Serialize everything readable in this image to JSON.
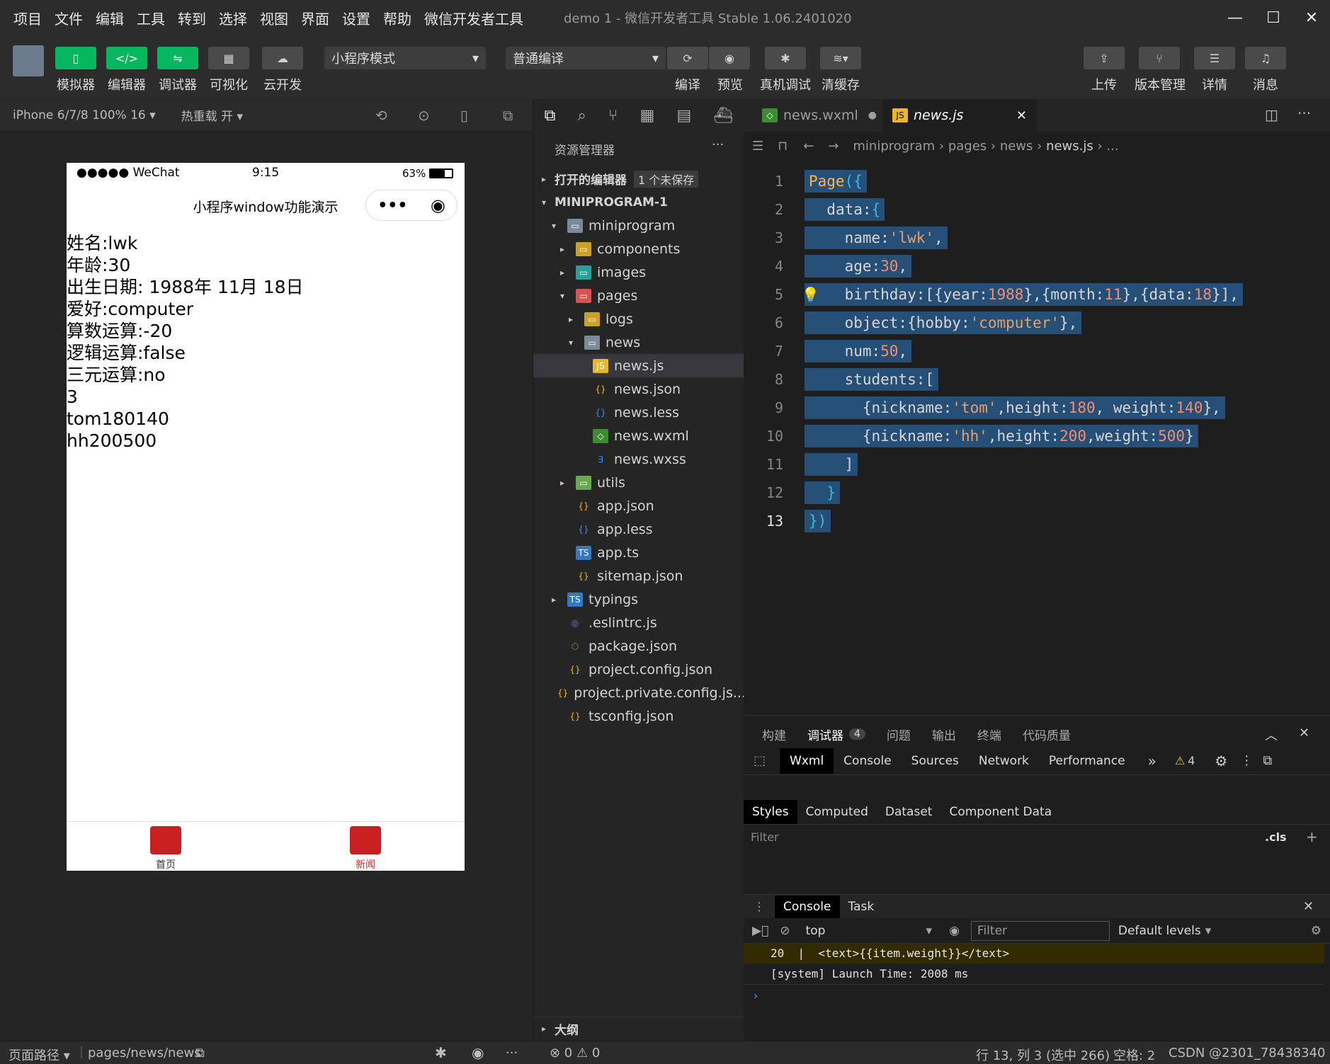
{
  "menubar": {
    "items": [
      "项目",
      "文件",
      "编辑",
      "工具",
      "转到",
      "选择",
      "视图",
      "界面",
      "设置",
      "帮助",
      "微信开发者工具"
    ],
    "title": "demo 1 - 微信开发者工具 Stable 1.06.2401020"
  },
  "toolbar": {
    "simulator": "模拟器",
    "editor": "编辑器",
    "debugger": "调试器",
    "visual": "可视化",
    "cloud": "云开发",
    "mode_select": "小程序模式",
    "compile_select": "普通编译",
    "compile": "编译",
    "preview": "预览",
    "real_debug": "真机调试",
    "clear_cache": "清缓存",
    "upload": "上传",
    "version": "版本管理",
    "details": "详情",
    "messages": "消息"
  },
  "simulator": {
    "device": "iPhone 6/7/8 100% 16 ▾",
    "hot_reload": "热重载 开 ▾",
    "status_left": "●●●●● WeChat",
    "status_time": "9:15",
    "status_battery": "63%",
    "nav_title": "小程序window功能演示",
    "lines": [
      "姓名:lwk",
      "年龄:30",
      "出生日期: 1988年 11月 18日",
      "爱好:computer",
      "算数运算:-20",
      "逻辑运算:false",
      "三元运算:no",
      "3",
      "tom180140",
      "hh200500"
    ],
    "tab_home": "首页",
    "tab_news": "新闻",
    "active_color": "#e02020"
  },
  "explorer": {
    "title": "资源管理器",
    "open_editors": "打开的编辑器",
    "unsaved": "1 个未保存",
    "project": "MINIPROGRAM-1",
    "outline": "大纲",
    "items": [
      {
        "label": "miniprogram",
        "indent": 1,
        "arrow": "▾",
        "icon": "folder"
      },
      {
        "label": "components",
        "indent": 2,
        "arrow": "▸",
        "icon": "folder-yellow"
      },
      {
        "label": "images",
        "indent": 2,
        "arrow": "▸",
        "icon": "folder-teal"
      },
      {
        "label": "pages",
        "indent": 2,
        "arrow": "▾",
        "icon": "folder-red"
      },
      {
        "label": "logs",
        "indent": 3,
        "arrow": "▸",
        "icon": "folder-yellow"
      },
      {
        "label": "news",
        "indent": 3,
        "arrow": "▾",
        "icon": "folder"
      },
      {
        "label": "news.js",
        "indent": 4,
        "arrow": "",
        "icon": "js",
        "selected": true
      },
      {
        "label": "news.json",
        "indent": 4,
        "arrow": "",
        "icon": "json"
      },
      {
        "label": "news.less",
        "indent": 4,
        "arrow": "",
        "icon": "less"
      },
      {
        "label": "news.wxml",
        "indent": 4,
        "arrow": "",
        "icon": "wxml"
      },
      {
        "label": "news.wxss",
        "indent": 4,
        "arrow": "",
        "icon": "css"
      },
      {
        "label": "utils",
        "indent": 2,
        "arrow": "▸",
        "icon": "folder-green"
      },
      {
        "label": "app.json",
        "indent": 2,
        "arrow": "",
        "icon": "json"
      },
      {
        "label": "app.less",
        "indent": 2,
        "arrow": "",
        "icon": "less"
      },
      {
        "label": "app.ts",
        "indent": 2,
        "arrow": "",
        "icon": "ts"
      },
      {
        "label": "sitemap.json",
        "indent": 2,
        "arrow": "",
        "icon": "json"
      },
      {
        "label": "typings",
        "indent": 1,
        "arrow": "▸",
        "icon": "folder-ts"
      },
      {
        "label": ".eslintrc.js",
        "indent": 1,
        "arrow": "",
        "icon": "eslint"
      },
      {
        "label": "package.json",
        "indent": 1,
        "arrow": "",
        "icon": "node"
      },
      {
        "label": "project.config.json",
        "indent": 1,
        "arrow": "",
        "icon": "json"
      },
      {
        "label": "project.private.config.js...",
        "indent": 1,
        "arrow": "",
        "icon": "json"
      },
      {
        "label": "tsconfig.json",
        "indent": 1,
        "arrow": "",
        "icon": "json"
      }
    ]
  },
  "editor": {
    "tab1": "news.wxml",
    "tab2": "news.js",
    "breadcrumb": [
      "miniprogram",
      "pages",
      "news",
      "news.js",
      "..."
    ],
    "code": [
      {
        "n": "1",
        "html": "<span class='kw'>Page</span><span class='brk'>({</span>"
      },
      {
        "n": "2",
        "html": "&nbsp;&nbsp;<span class='key'>data:</span><span class='brk'>{</span>"
      },
      {
        "n": "3",
        "html": "&nbsp;&nbsp;&nbsp;&nbsp;<span class='key'>name:</span><span class='str'>'lwk'</span><span class='key'>,</span>"
      },
      {
        "n": "4",
        "html": "&nbsp;&nbsp;&nbsp;&nbsp;<span class='key'>age:</span><span class='num'>30</span><span class='key'>,</span>"
      },
      {
        "n": "5",
        "html": "&nbsp;&nbsp;&nbsp;&nbsp;<span class='key'>birthday:[{year:</span><span class='num'>1988</span><span class='key'>},{month:</span><span class='num'>11</span><span class='key'>},{data:</span><span class='num'>18</span><span class='key'>}],</span>"
      },
      {
        "n": "6",
        "html": "&nbsp;&nbsp;&nbsp;&nbsp;<span class='key'>object:{hobby:</span><span class='str'>'computer'</span><span class='key'>},</span>"
      },
      {
        "n": "7",
        "html": "&nbsp;&nbsp;&nbsp;&nbsp;<span class='key'>num:</span><span class='num'>50</span><span class='key'>,</span>"
      },
      {
        "n": "8",
        "html": "&nbsp;&nbsp;&nbsp;&nbsp;<span class='key'>students:[</span>"
      },
      {
        "n": "9",
        "html": "&nbsp;&nbsp;&nbsp;&nbsp;&nbsp;&nbsp;<span class='key'>{nickname:</span><span class='str'>'tom'</span><span class='key'>,height:</span><span class='num'>180</span><span class='key'>, weight:</span><span class='num'>140</span><span class='key'>},</span>"
      },
      {
        "n": "10",
        "html": "&nbsp;&nbsp;&nbsp;&nbsp;&nbsp;&nbsp;<span class='key'>{nickname:</span><span class='str'>'hh'</span><span class='key'>,height:</span><span class='num'>200</span><span class='key'>,weight:</span><span class='num'>500</span><span class='key'>}</span>"
      },
      {
        "n": "11",
        "html": "&nbsp;&nbsp;&nbsp;&nbsp;<span class='key'>]</span>"
      },
      {
        "n": "12",
        "html": "&nbsp;&nbsp;<span class='brk'>}</span>"
      },
      {
        "n": "13",
        "html": "<span class='brk'>})</span>"
      }
    ]
  },
  "panel": {
    "tabs": [
      "构建",
      "调试器",
      "问题",
      "输出",
      "终端",
      "代码质量"
    ],
    "debugger_badge": "4",
    "devtabs": [
      "Wxml",
      "Console",
      "Sources",
      "Network",
      "Performance"
    ],
    "warn_count": "4",
    "style_tabs": [
      "Styles",
      "Computed",
      "Dataset",
      "Component Data"
    ],
    "filter": "Filter",
    "cls": ".cls",
    "console_tabs": [
      "Console",
      "Task"
    ],
    "context": "top",
    "filter2": "Filter",
    "levels": "Default levels",
    "log_code": "20  |  <text>{{item.weight}}</text>",
    "log_line": "[system] Launch Time: 2008 ms"
  },
  "status": {
    "path_label": "页面路径 ▾",
    "path": "pages/news/news",
    "errors": "⊗ 0 ⚠ 0",
    "position": "行 13, 列 3 (选中 266)",
    "spaces": "空格: 2",
    "watermark": "CSDN @2301_78438340"
  }
}
